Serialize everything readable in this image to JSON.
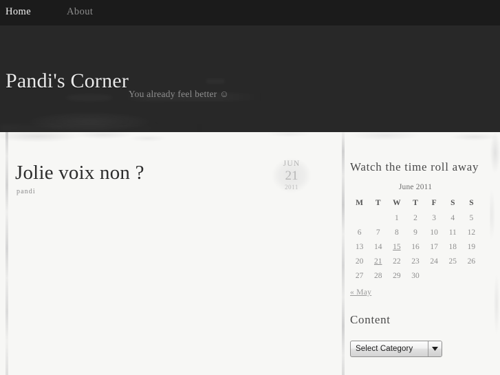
{
  "nav": {
    "items": [
      {
        "label": "Home",
        "active": true
      },
      {
        "label": "About",
        "active": false
      }
    ]
  },
  "header": {
    "site_title": "Pandi's Corner",
    "tagline": "You already feel better ☺"
  },
  "main": {
    "post": {
      "title": "Jolie voix non ?",
      "author": "pandi",
      "date": {
        "month": "JUN",
        "day": "21",
        "year": "2011"
      }
    }
  },
  "sidebar": {
    "calendar": {
      "title": "Watch the time roll away",
      "caption": "June 2011",
      "weekdays": [
        "M",
        "T",
        "W",
        "T",
        "F",
        "S",
        "S"
      ],
      "weeks": [
        [
          "",
          "",
          "1",
          "2",
          "3",
          "4",
          "5"
        ],
        [
          "6",
          "7",
          "8",
          "9",
          "10",
          "11",
          "12"
        ],
        [
          "13",
          "14",
          "15",
          "16",
          "17",
          "18",
          "19"
        ],
        [
          "20",
          "21",
          "22",
          "23",
          "24",
          "25",
          "26"
        ],
        [
          "27",
          "28",
          "29",
          "30",
          "",
          "",
          ""
        ]
      ],
      "linked_days": [
        "15",
        "21"
      ],
      "prev_label": "« May"
    },
    "categories": {
      "title": "Content",
      "select_value": "Select Category"
    }
  },
  "colors": {
    "nav_bg": "#1b1b1b",
    "header_bg": "#282828",
    "page_bg": "#f7f7f5",
    "title_text": "#e9e9e9",
    "muted_text": "#8e8e8e"
  }
}
